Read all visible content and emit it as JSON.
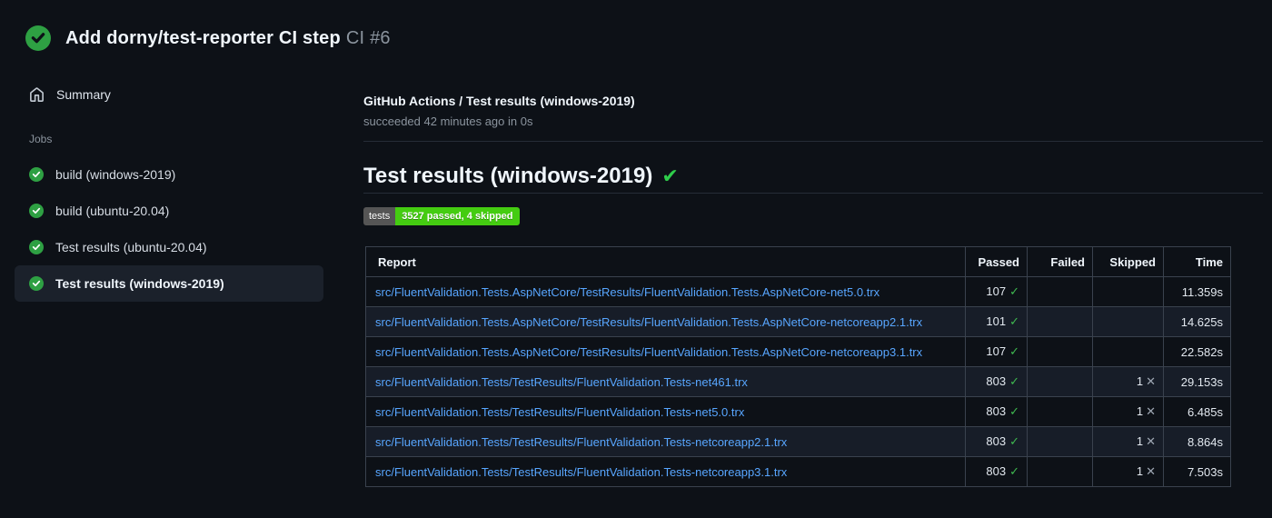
{
  "header": {
    "title": "Add dorny/test-reporter CI step",
    "run_number": "CI #6"
  },
  "sidebar": {
    "summary_label": "Summary",
    "jobs_label": "Jobs",
    "jobs": [
      {
        "label": "build (windows-2019)",
        "status": "success",
        "selected": false
      },
      {
        "label": "build (ubuntu-20.04)",
        "status": "success",
        "selected": false
      },
      {
        "label": "Test results (ubuntu-20.04)",
        "status": "success",
        "selected": false
      },
      {
        "label": "Test results (windows-2019)",
        "status": "success",
        "selected": true
      }
    ]
  },
  "main": {
    "check_title": "GitHub Actions / Test results (windows-2019)",
    "check_status": "succeeded 42 minutes ago in 0s",
    "report_heading": "Test results (windows-2019)",
    "badge": {
      "label": "tests",
      "message": "3527 passed, 4 skipped",
      "label_bg": "#555555",
      "message_bg": "#44cc11"
    },
    "table": {
      "columns": [
        "Report",
        "Passed",
        "Failed",
        "Skipped",
        "Time"
      ],
      "rows": [
        {
          "report": "src/FluentValidation.Tests.AspNetCore/TestResults/FluentValidation.Tests.AspNetCore-net5.0.trx",
          "passed": "107",
          "failed": "",
          "skipped": "",
          "time": "11.359s"
        },
        {
          "report": "src/FluentValidation.Tests.AspNetCore/TestResults/FluentValidation.Tests.AspNetCore-netcoreapp2.1.trx",
          "passed": "101",
          "failed": "",
          "skipped": "",
          "time": "14.625s"
        },
        {
          "report": "src/FluentValidation.Tests.AspNetCore/TestResults/FluentValidation.Tests.AspNetCore-netcoreapp3.1.trx",
          "passed": "107",
          "failed": "",
          "skipped": "",
          "time": "22.582s"
        },
        {
          "report": "src/FluentValidation.Tests/TestResults/FluentValidation.Tests-net461.trx",
          "passed": "803",
          "failed": "",
          "skipped": "1",
          "time": "29.153s"
        },
        {
          "report": "src/FluentValidation.Tests/TestResults/FluentValidation.Tests-net5.0.trx",
          "passed": "803",
          "failed": "",
          "skipped": "1",
          "time": "6.485s"
        },
        {
          "report": "src/FluentValidation.Tests/TestResults/FluentValidation.Tests-netcoreapp2.1.trx",
          "passed": "803",
          "failed": "",
          "skipped": "1",
          "time": "8.864s"
        },
        {
          "report": "src/FluentValidation.Tests/TestResults/FluentValidation.Tests-netcoreapp3.1.trx",
          "passed": "803",
          "failed": "",
          "skipped": "1",
          "time": "7.503s"
        }
      ]
    }
  },
  "icons": {
    "check": "✓",
    "cross": "✕",
    "heading_check": "✔"
  },
  "colors": {
    "background": "#0d1117",
    "success_green": "#2ea043",
    "check_green": "#3fb950",
    "link_blue": "#58a6ff",
    "muted_text": "#8b949e",
    "table_border": "#3a424e",
    "row_alt": "#171d28"
  }
}
